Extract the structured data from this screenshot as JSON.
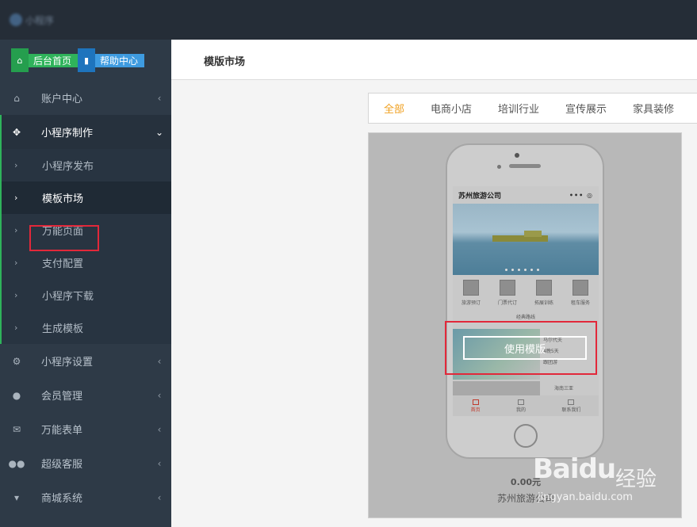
{
  "header": {
    "logo_text": "小程序"
  },
  "quick_links": {
    "home": "后台首页",
    "help": "帮助中心"
  },
  "menu": {
    "account": "账户中心",
    "miniapp_make": "小程序制作",
    "submenu": [
      "小程序发布",
      "模板市场",
      "万能页面",
      "支付配置",
      "小程序下载",
      "生成模板"
    ],
    "miniapp_settings": "小程序设置",
    "members": "会员管理",
    "forms": "万能表单",
    "service": "超级客服",
    "shop": "商城系统"
  },
  "page_title": "模版市场",
  "tabs": [
    "全部",
    "电商小店",
    "培训行业",
    "宣传展示",
    "家具装修"
  ],
  "template": {
    "app_title": "苏州旅游公司",
    "header_icons": "••• ◎",
    "icons": [
      "旅游预订",
      "门票代订",
      "拓展训练",
      "租车服务"
    ],
    "section_title": "经典路线",
    "route1_side": [
      "马尔代夫",
      "4晚5天",
      "跟团游"
    ],
    "route2_side": "海南三亚",
    "nav": [
      "首页",
      "我的",
      "联系我们"
    ],
    "use_button": "使用模版",
    "price": "0.00元",
    "name": "苏州旅游公司"
  },
  "watermark": {
    "brand": "Baidu",
    "cn": "经验",
    "url": "jingyan.baidu.com"
  },
  "colors": {
    "sidebar": "#2e3a47",
    "accent_green": "#2fb35b",
    "tab_active": "#f0a020",
    "highlight": "#e2283a"
  }
}
